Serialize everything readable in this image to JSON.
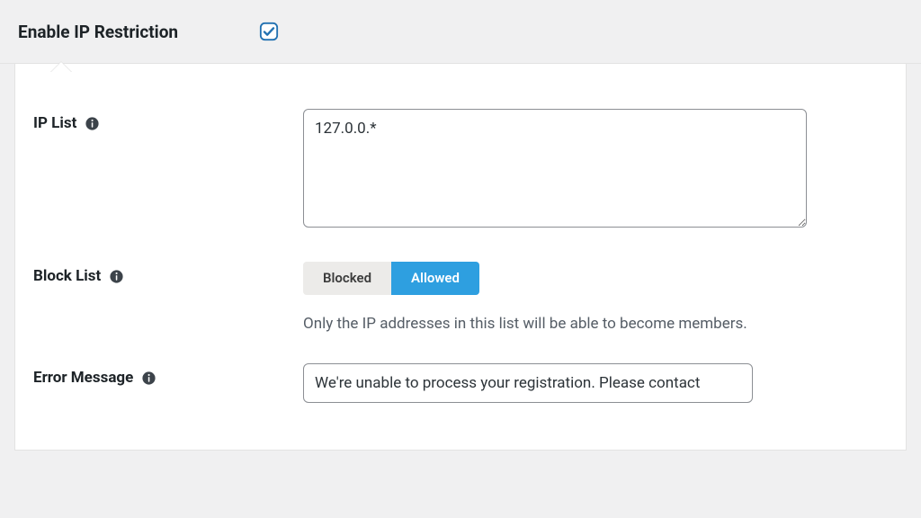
{
  "header": {
    "enable_label": "Enable IP Restriction",
    "checked": true
  },
  "ip_list": {
    "label": "IP List",
    "value": "127.0.0.*"
  },
  "block_list": {
    "label": "Block List",
    "options": {
      "blocked": "Blocked",
      "allowed": "Allowed"
    },
    "selected": "allowed",
    "helper": "Only the IP addresses in this list will be able to become members."
  },
  "error_message": {
    "label": "Error Message",
    "value": "We're unable to process your registration. Please contact"
  }
}
